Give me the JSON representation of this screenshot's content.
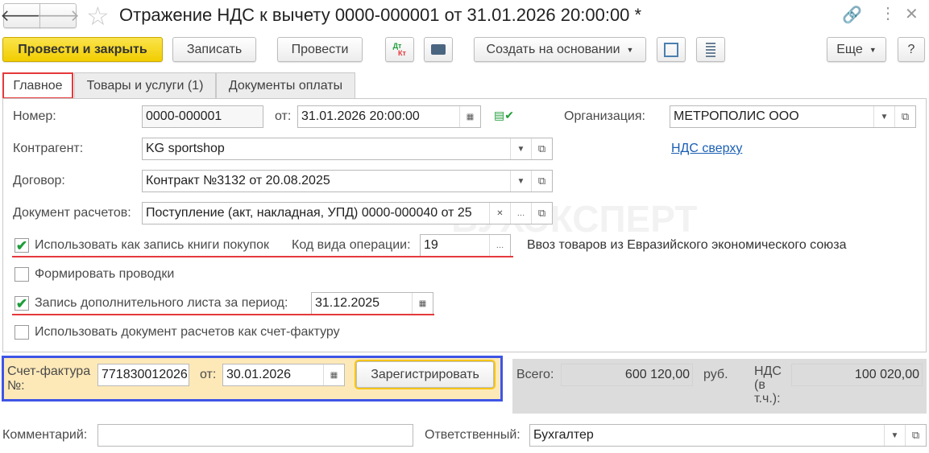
{
  "title": "Отражение НДС к вычету 0000-000001 от 31.01.2026 20:00:00 *",
  "toolbar": {
    "post_close": "Провести и закрыть",
    "save": "Записать",
    "post": "Провести",
    "dtkt_dt": "Дт",
    "dtkt_kt": "Кт",
    "create_based": "Создать на основании",
    "more": "Еще",
    "help": "?"
  },
  "tabs": [
    "Главное",
    "Товары и услуги (1)",
    "Документы оплаты"
  ],
  "form": {
    "number_label": "Номер:",
    "number": "0000-000001",
    "date_label": "от:",
    "date": "31.01.2026 20:00:00",
    "org_label": "Организация:",
    "org": "МЕТРОПОЛИС ООО",
    "counterparty_label": "Контрагент:",
    "counterparty": "KG sportshop",
    "vat_link": "НДС сверху",
    "contract_label": "Договор:",
    "contract": "Контракт №3132 от 20.08.2025",
    "settlement_label": "Документ расчетов:",
    "settlement": "Поступление (акт, накладная, УПД) 0000-000040 от 25",
    "use_purchase_book": "Использовать как запись книги покупок",
    "use_purchase_book_checked": true,
    "op_code_label": "Код вида операции:",
    "op_code": "19",
    "op_code_desc": "Ввоз товаров из Евразийского экономического союза",
    "make_entries": "Формировать проводки",
    "make_entries_checked": false,
    "extra_sheet": "Запись дополнительного листа за период:",
    "extra_sheet_checked": true,
    "extra_sheet_date": "31.12.2025",
    "use_as_invoice": "Использовать документ расчетов как счет-фактуру",
    "use_as_invoice_checked": false
  },
  "invoice": {
    "label1": "Счет-фактура",
    "label2": "№:",
    "number": "771830012026",
    "date_label": "от:",
    "date": "30.01.2026",
    "register": "Зарегистрировать"
  },
  "totals": {
    "total_label": "Всего:",
    "total": "600 120,00",
    "currency": "руб.",
    "vat_label1": "НДС",
    "vat_label2": "(в",
    "vat_label3": "т.ч.):",
    "vat": "100 020,00"
  },
  "footer": {
    "comment_label": "Комментарий:",
    "comment": "",
    "responsible_label": "Ответственный:",
    "responsible": "Бухгалтер"
  },
  "watermark": "БУХЭКСПЕРТ"
}
